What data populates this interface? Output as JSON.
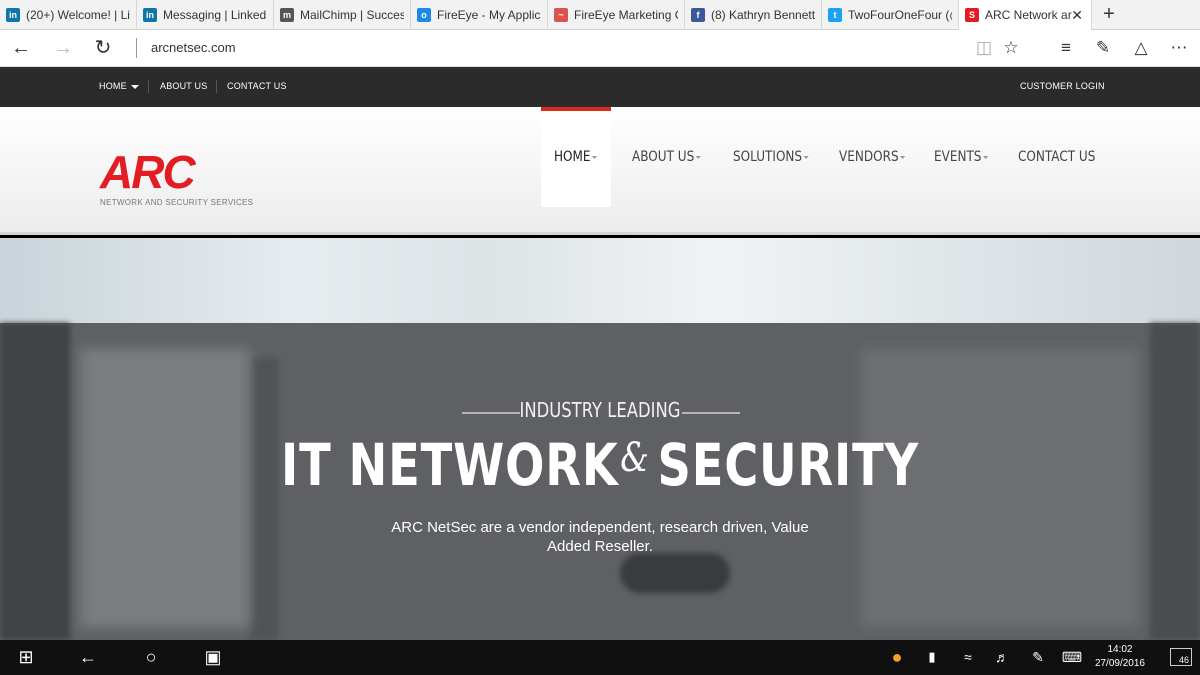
{
  "browser": {
    "tabs": [
      {
        "title": "(20+) Welcome! | Li",
        "favicon": "linkedin-icon",
        "color": "#0e76a8",
        "glyph": "in"
      },
      {
        "title": "Messaging | LinkedI",
        "favicon": "linkedin-icon",
        "color": "#0e76a8",
        "glyph": "in"
      },
      {
        "title": "MailChimp | Succes",
        "favicon": "mailchimp-icon",
        "color": "#555555",
        "glyph": "m"
      },
      {
        "title": "FireEye - My Applica",
        "favicon": "fireeye-icon",
        "color": "#1e88e5",
        "glyph": "o"
      },
      {
        "title": "FireEye Marketing C",
        "favicon": "fireeye-marketing-icon",
        "color": "#d9534f",
        "glyph": "~"
      },
      {
        "title": "(8) Kathryn Bennett",
        "favicon": "facebook-icon",
        "color": "#3b5998",
        "glyph": "f"
      },
      {
        "title": "TwoFourOneFour (@",
        "favicon": "twitter-icon",
        "color": "#1da1f2",
        "glyph": "t"
      },
      {
        "title": "ARC Network ar",
        "favicon": "arc-icon",
        "color": "#e31b23",
        "glyph": "S",
        "active": true
      }
    ],
    "url": "arcnetsec.com"
  },
  "topbar": {
    "home": "HOME",
    "about": "ABOUT US",
    "contact": "CONTACT US",
    "login": "CUSTOMER LOGIN"
  },
  "header": {
    "logo": "ARC",
    "tagline": "NETWORK AND SECURITY SERVICES",
    "menu": {
      "home": "HOME",
      "about": "ABOUT US",
      "solutions": "SOLUTIONS",
      "vendors": "VENDORS",
      "events": "EVENTS",
      "contact": "CONTACT US"
    },
    "accent": "#d72a1e",
    "brand_color": "#e31b23"
  },
  "hero": {
    "kicker": "INDUSTRY LEADING",
    "title_left": "IT NETWORK",
    "title_amp": "&",
    "title_right": "SECURITY",
    "description": "ARC NetSec are a vendor independent, research driven, Value Added Reseller."
  },
  "taskbar": {
    "time": "14:02",
    "date": "27/09/2016",
    "notifications": "46"
  }
}
